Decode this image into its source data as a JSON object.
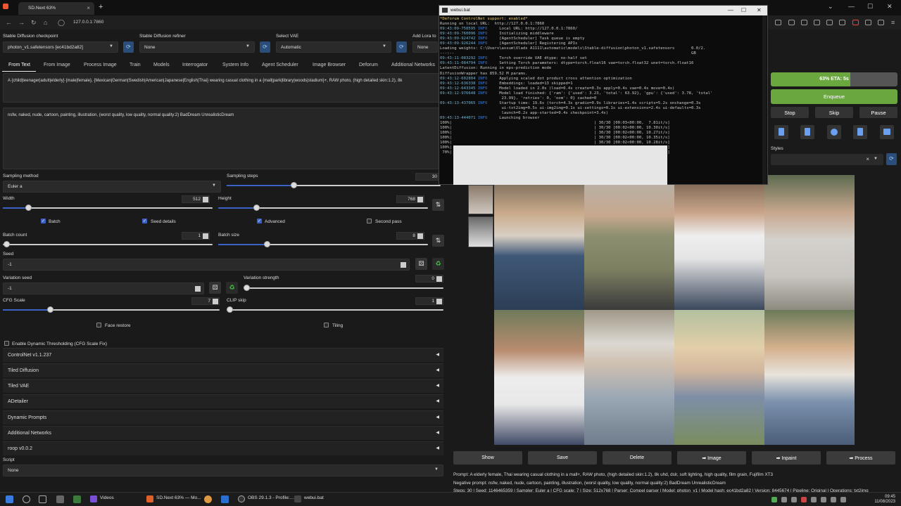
{
  "browser": {
    "tab_title": "SD.Next 63%",
    "url": "127.0.0.1:7860"
  },
  "top": {
    "checkpoint_label": "Stable Diffusion checkpoint",
    "checkpoint_value": "photon_v1.safetensors [ec41bd2a82]",
    "refiner_label": "Stable Diffusion refiner",
    "refiner_value": "None",
    "vae_label": "Select VAE",
    "vae_value": "Automatic",
    "lora_label": "Add Lora to",
    "lora_value": "None"
  },
  "tabs": [
    "From Text",
    "From Image",
    "Process Image",
    "Train",
    "Models",
    "Interrogator",
    "System Info",
    "Agent Scheduler",
    "Image Browser",
    "Deforum",
    "Additional Networks"
  ],
  "prompt": "A {child|teenager|adult|elderly} {male|female}, {Mexican|German|Swedish|American|Japanese|English|Thai} wearing casual clothing in a {mall|park|library|woods|stadium}+, RAW photo, (high detailed skin:1.2), 8k",
  "negative_prompt": "nsfw, naked, nude, cartoon, painting, illustration, (worst quality, low quality, normal quality:2) BadDream UnrealisticDream",
  "params": {
    "sampling_method_label": "Sampling method",
    "sampling_method_value": "Euler a",
    "sampling_steps_label": "Sampling steps",
    "sampling_steps_value": "30",
    "width_label": "Width",
    "width_value": "512",
    "height_label": "Height",
    "height_value": "768",
    "batch_label": "Batch",
    "seed_details_label": "Seed details",
    "advanced_label": "Advanced",
    "second_pass_label": "Second pass",
    "batch_count_label": "Batch count",
    "batch_count_value": "1",
    "batch_size_label": "Batch size",
    "batch_size_value": "8",
    "seed_label": "Seed",
    "seed_value": "-1",
    "variation_seed_label": "Variation seed",
    "variation_seed_value": "-1",
    "variation_strength_label": "Variation strength",
    "variation_strength_value": "0",
    "cfg_label": "CFG Scale",
    "cfg_value": "7",
    "clip_label": "CLIP skip",
    "clip_value": "1",
    "face_restore_label": "Face restore",
    "tiling_label": "Tiling",
    "dynamic_label": "Enable Dynamic Thresholding (CFG Scale Fix)"
  },
  "accordions": [
    "ControlNet v1.1.237",
    "Tiled Diffusion",
    "Tiled VAE",
    "ADetailer",
    "Dynamic Prompts",
    "Additional Networks",
    "roop v0.0.2"
  ],
  "script_label": "Script",
  "script_value": "None",
  "console": {
    "title": "webui.bat",
    "lines": [
      "*Deforum ControlNet support: enabled*",
      "Running on local URL:  http://127.0.0.1:7860",
      "09:43:09-758595 INFO     Local URL: http://127.0.0.1:7860/",
      "09:43:09-760096 INFO     Initializing middleware",
      "09:43:09-924742 INFO     [AgentScheduler] Task queue is empty",
      "09:43:09-926244 INFO     [AgentScheduler] Registering APIs",
      "Loading weights: C:\\Users\\assum\\Vlads A1111\\automatic\\models\\Stable-diffusion\\photon_v1.safetensors       0.0/2.",
      "---:--                                                                                                    GB",
      "09:43:11-083292 INFO     Torch override VAE dtype: no-half set",
      "09:43:11-084794 INFO     Setting Torch parameters: dtype=torch.float16 vae=torch.float32 unet=torch.float16",
      "LatentDiffusion: Running in eps-prediction mode",
      "DiffusionWrapper has 859.52 M params.",
      "09:43:12-602804 INFO     Applying scaled dot product cross attention optimization",
      "09:43:12-636338 INFO     Embeddings: loaded=13 skipped=1",
      "09:43:12-643345 INFO     Model loaded in 2.0s (load=0.4s create=0.3s apply=0.4s vae=0.4s move=0.4s)",
      "09:43:12-976648 INFO     Model load finished: {'ram': {'used': 3.23, 'total': 63.92}, 'gpu': {'used': 3.78, 'total'",
      "                          23.99}, 'retries': 0, 'oom': 0} cached=0",
      "09:43:13-437065 INFO     Startup time: 19.6s (torch=4.3s gradio=0.9s libraries=1.4s scripts=5.2s onchange=0.3s",
      "                          ui-txt2img=0.5s ui-img2img=0.1s ui-settings=0.1s ui-extensions=2.4s ui-defaults=0.3s",
      "                          launch=0.2s app-started=0.4s checkpoint=3.4s)",
      "09:43:13-444071 INFO     Launching browser",
      "100%|                                                            | 30/30 [00:03<00:00,  7.81it/s]",
      "100%|                                                            | 30/30 [00:02<00:00, 10.30it/s]",
      "100%|                                                            | 30/30 [00:02<00:00, 10.27it/s]",
      "100%|                                                            | 30/30 [00:02<00:00, 10.35it/s]",
      "100%|                                                            | 30/30 [00:02<00:00, 10.28it/s]",
      "100%|                                                            | 30/30 [00:05<00:00,  5.83it/s]",
      " 70%|                                                            | 21/30 [00:07<00:02,  3.28it/s]"
    ]
  },
  "progress": {
    "text": "63% ETA: 5s",
    "fraction": 0.63
  },
  "buttons": {
    "enqueue": "Enqueue",
    "stop": "Stop",
    "skip": "Skip",
    "pause": "Pause",
    "styles_label": "Styles"
  },
  "gallery_buttons": [
    "Show",
    "Save",
    "Delete",
    "➡ Image",
    "➡ Inpaint",
    "➡ Process"
  ],
  "info": {
    "prompt_line": "Prompt: A elderly female, Thai wearing casual clothing in a mall+, RAW photo, (high detailed skin:1.2), 8k uhd, dslr, soft lighting, high quality, film grain, Fujifilm XT3",
    "negative_line": "Negative prompt: nsfw, naked, nude, cartoon, painting, illustration, (worst quality, low quality, normal quality:2) BadDream UnrealisticDream",
    "steps_line": "Steps: 30 | Seed: 1146465359 | Sampler: Euler a | CFG scale: 7 | Size: 512x768 | Parser: Compel parser | Model: photon_v1 | Model hash: ec41bd2a82 | Version: 8445674 | Pipeline: Original | Operations: txt2img"
  },
  "taskbar": {
    "items": [
      "Videos",
      "SD.Next 63% — Mo...",
      "OBS 29.1.3 - Profile:...",
      "webui.bat"
    ],
    "time": "09:45",
    "date": "11/08/2023"
  },
  "colors": {
    "accent": "#3b63c5",
    "progress_green": "#6aa73f"
  }
}
